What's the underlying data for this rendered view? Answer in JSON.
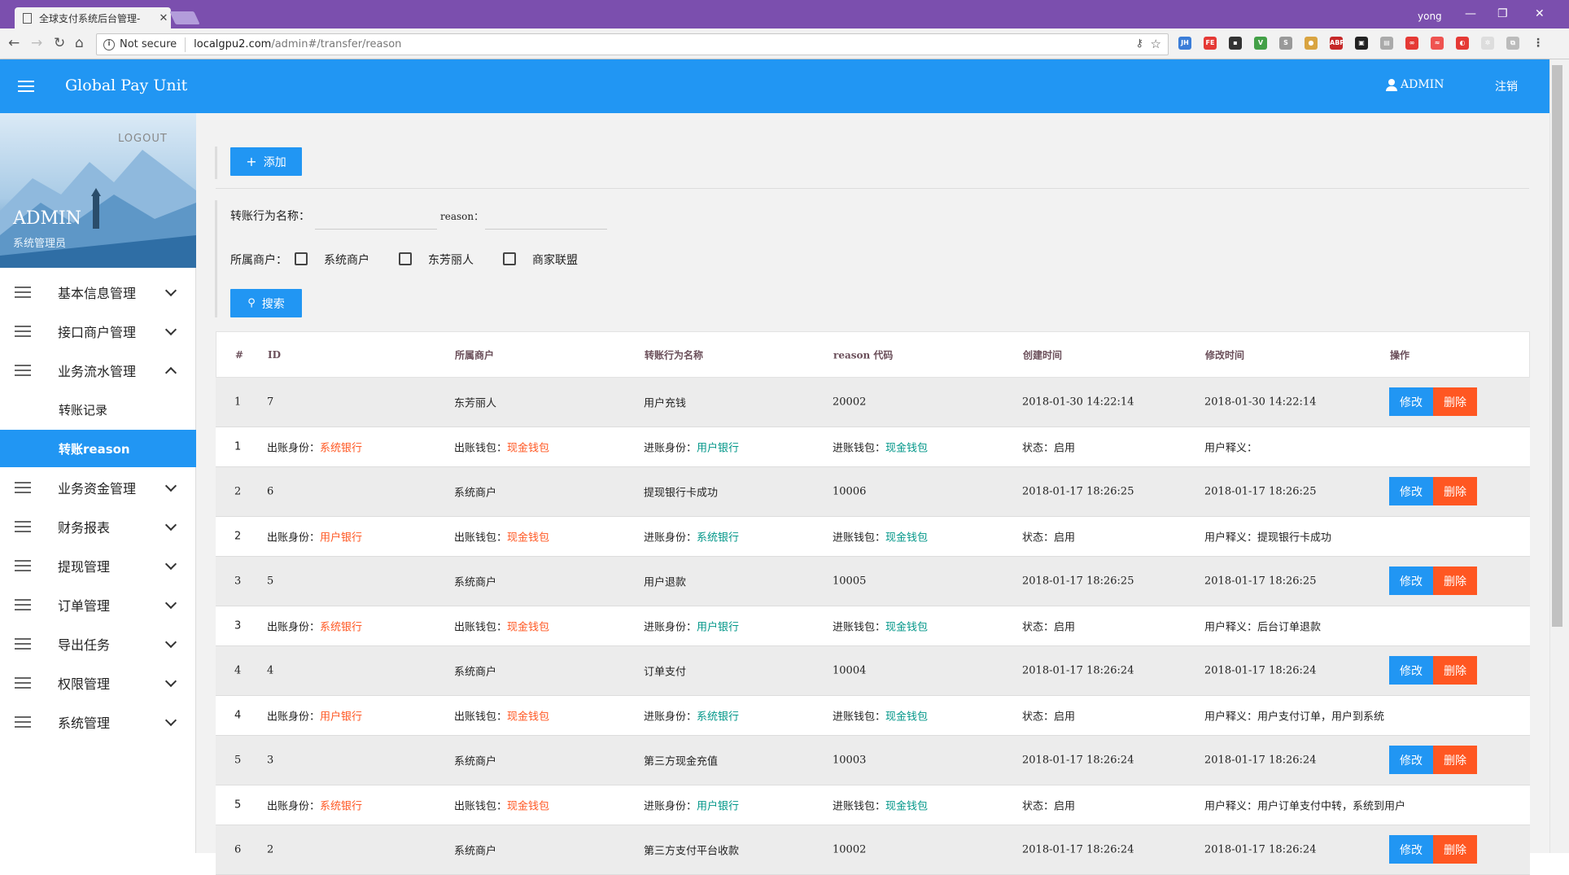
{
  "browser": {
    "tab_title": "全球支付系统后台管理-",
    "url_security": "Not secure",
    "url_host": "localgpu2.com",
    "url_path": "/admin#/transfer/reason",
    "window_user": "yong"
  },
  "header": {
    "brand": "Global Pay Unit",
    "user": "ADMIN",
    "logout": "注销"
  },
  "profile": {
    "logout": "LOGOUT",
    "name": "ADMIN",
    "role": "系统管理员"
  },
  "sidebar": {
    "items": [
      {
        "label": "基本信息管理"
      },
      {
        "label": "接口商户管理"
      },
      {
        "label": "业务流水管理"
      },
      {
        "label": "业务资金管理"
      },
      {
        "label": "财务报表"
      },
      {
        "label": "提现管理"
      },
      {
        "label": "订单管理"
      },
      {
        "label": "导出任务"
      },
      {
        "label": "权限管理"
      },
      {
        "label": "系统管理"
      }
    ],
    "sub_items": [
      {
        "label": "转账记录"
      },
      {
        "label": "转账reason"
      }
    ]
  },
  "toolbar": {
    "add_label": "添加",
    "search_label": "搜索"
  },
  "filters": {
    "name_label": "转账行为名称：",
    "reason_label": "reason：",
    "merchant_label": "所属商户：",
    "options": [
      "系统商户",
      "东芳丽人",
      "商家联盟"
    ]
  },
  "table": {
    "headers": [
      "#",
      "ID",
      "所属商户",
      "转账行为名称",
      "reason 代码",
      "创建时间",
      "修改时间",
      "操作"
    ],
    "edit_label": "修改",
    "delete_label": "删除",
    "rows": [
      {
        "idx": "1",
        "id": "7",
        "merchant": "东芳丽人",
        "name": "用户充钱",
        "code": "20002",
        "created": "2018-01-30 14:22:14",
        "modified": "2018-01-30 14:22:14",
        "detail": {
          "out_id_k": "出账身份：",
          "out_id_v": "系统银行",
          "out_wallet_k": "出账钱包：",
          "out_wallet_v": "现金钱包",
          "in_id_k": "进账身份：",
          "in_id_v": "用户银行",
          "in_wallet_k": "进账钱包：",
          "in_wallet_v": "现金钱包",
          "status": "状态：启用",
          "desc": "用户释义："
        }
      },
      {
        "idx": "2",
        "id": "6",
        "merchant": "系统商户",
        "name": "提现银行卡成功",
        "code": "10006",
        "created": "2018-01-17 18:26:25",
        "modified": "2018-01-17 18:26:25",
        "detail": {
          "out_id_k": "出账身份：",
          "out_id_v": "用户银行",
          "out_wallet_k": "出账钱包：",
          "out_wallet_v": "现金钱包",
          "in_id_k": "进账身份：",
          "in_id_v": "系统银行",
          "in_wallet_k": "进账钱包：",
          "in_wallet_v": "现金钱包",
          "status": "状态：启用",
          "desc": "用户释义：提现银行卡成功"
        }
      },
      {
        "idx": "3",
        "id": "5",
        "merchant": "系统商户",
        "name": "用户退款",
        "code": "10005",
        "created": "2018-01-17 18:26:25",
        "modified": "2018-01-17 18:26:25",
        "detail": {
          "out_id_k": "出账身份：",
          "out_id_v": "系统银行",
          "out_wallet_k": "出账钱包：",
          "out_wallet_v": "现金钱包",
          "in_id_k": "进账身份：",
          "in_id_v": "用户银行",
          "in_wallet_k": "进账钱包：",
          "in_wallet_v": "现金钱包",
          "status": "状态：启用",
          "desc": "用户释义：后台订单退款"
        }
      },
      {
        "idx": "4",
        "id": "4",
        "merchant": "系统商户",
        "name": "订单支付",
        "code": "10004",
        "created": "2018-01-17 18:26:24",
        "modified": "2018-01-17 18:26:24",
        "detail": {
          "out_id_k": "出账身份：",
          "out_id_v": "用户银行",
          "out_wallet_k": "出账钱包：",
          "out_wallet_v": "现金钱包",
          "in_id_k": "进账身份：",
          "in_id_v": "系统银行",
          "in_wallet_k": "进账钱包：",
          "in_wallet_v": "现金钱包",
          "status": "状态：启用",
          "desc": "用户释义：用户支付订单，用户到系统"
        }
      },
      {
        "idx": "5",
        "id": "3",
        "merchant": "系统商户",
        "name": "第三方现金充值",
        "code": "10003",
        "created": "2018-01-17 18:26:24",
        "modified": "2018-01-17 18:26:24",
        "detail": {
          "out_id_k": "出账身份：",
          "out_id_v": "系统银行",
          "out_wallet_k": "出账钱包：",
          "out_wallet_v": "现金钱包",
          "in_id_k": "进账身份：",
          "in_id_v": "用户银行",
          "in_wallet_k": "进账钱包：",
          "in_wallet_v": "现金钱包",
          "status": "状态：启用",
          "desc": "用户释义：用户订单支付中转，系统到用户"
        }
      },
      {
        "idx": "6",
        "id": "2",
        "merchant": "系统商户",
        "name": "第三方支付平台收款",
        "code": "10002",
        "created": "2018-01-17 18:26:24",
        "modified": "2018-01-17 18:26:24"
      }
    ]
  },
  "colors": {
    "primary": "#2196f3",
    "danger": "#ff5722",
    "teal": "#009688",
    "chrome": "#7b4fae"
  }
}
